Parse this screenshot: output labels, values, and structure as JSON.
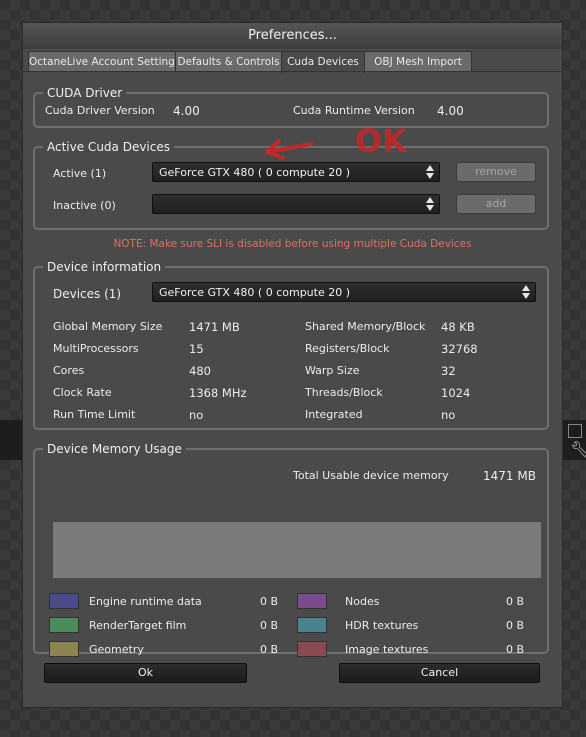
{
  "dialog": {
    "title": "Preferences..."
  },
  "tabs": [
    {
      "label": "OctaneLive Account Settings"
    },
    {
      "label": "Defaults & Controls"
    },
    {
      "label": "Cuda Devices"
    },
    {
      "label": "OBJ Mesh Import"
    }
  ],
  "cuda_driver": {
    "title": "CUDA Driver",
    "driver_version_label": "Cuda Driver Version",
    "driver_version": "4.00",
    "runtime_version_label": "Cuda Runtime Version",
    "runtime_version": "4.00"
  },
  "active_devices": {
    "title": "Active Cuda Devices",
    "active_label": "Active (1)",
    "active_selected": "GeForce GTX 480 ( 0 compute 20 )",
    "remove_label": "remove",
    "inactive_label": "Inactive (0)",
    "inactive_selected": "",
    "add_label": "add",
    "annotation": "OK",
    "note": "NOTE: Make sure SLI is disabled before using multiple Cuda Devices"
  },
  "device_info": {
    "title": "Device information",
    "devices_label": "Devices (1)",
    "devices_selected": "GeForce GTX 480 ( 0 compute 20 )",
    "left": [
      {
        "label": "Global Memory Size",
        "value": "1471 MB"
      },
      {
        "label": "MultiProcessors",
        "value": "15"
      },
      {
        "label": "Cores",
        "value": "480"
      },
      {
        "label": "Clock Rate",
        "value": "1368 MHz"
      },
      {
        "label": "Run Time Limit",
        "value": "no"
      }
    ],
    "right": [
      {
        "label": "Shared Memory/Block",
        "value": "48 KB"
      },
      {
        "label": "Registers/Block",
        "value": "32768"
      },
      {
        "label": "Warp Size",
        "value": "32"
      },
      {
        "label": "Threads/Block",
        "value": "1024"
      },
      {
        "label": "Integrated",
        "value": "no"
      }
    ]
  },
  "memory_usage": {
    "title": "Device Memory Usage",
    "total_label": "Total Usable device memory",
    "total_value": "1471 MB",
    "legend_left": [
      {
        "label": "Engine runtime data",
        "value": "0 B",
        "color": "#4a4a8c"
      },
      {
        "label": "RenderTarget film",
        "value": "0 B",
        "color": "#4a8c5a"
      },
      {
        "label": "Geometry",
        "value": "0 B",
        "color": "#8c8450"
      }
    ],
    "legend_right": [
      {
        "label": "Nodes",
        "value": "0 B",
        "color": "#7a4a8c"
      },
      {
        "label": "HDR textures",
        "value": "0 B",
        "color": "#4a8290"
      },
      {
        "label": "Image textures",
        "value": "0 B",
        "color": "#8c4a50"
      }
    ]
  },
  "buttons": {
    "ok_label": "Ok",
    "cancel_label": "Cancel"
  }
}
